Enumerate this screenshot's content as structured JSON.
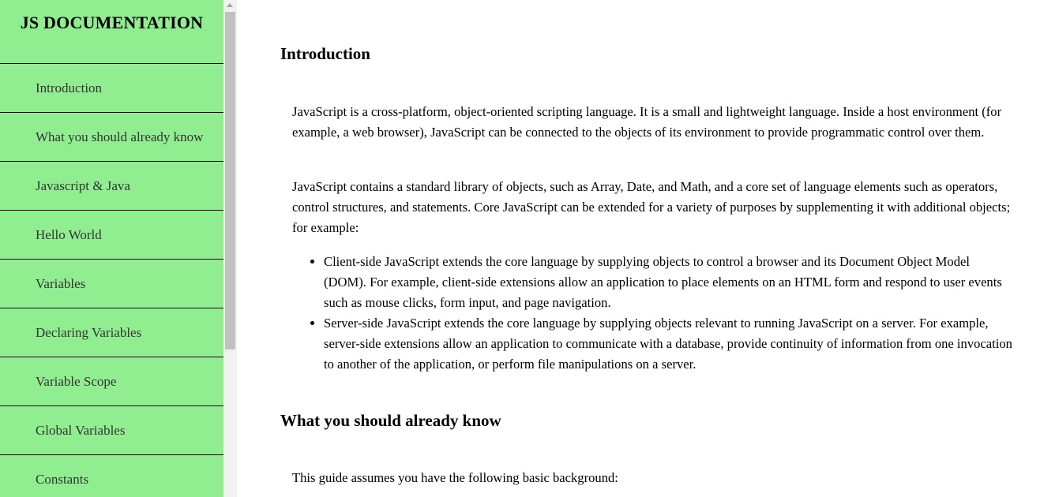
{
  "navbar": {
    "title": "JS DOCUMENTATION",
    "links": [
      "Introduction",
      "What you should already know",
      "Javascript & Java",
      "Hello World",
      "Variables",
      "Declaring Variables",
      "Variable Scope",
      "Global Variables",
      "Constants"
    ]
  },
  "sections": {
    "introduction": {
      "heading": "Introduction",
      "p1": "JavaScript is a cross-platform, object-oriented scripting language. It is a small and lightweight language. Inside a host environment (for example, a web browser), JavaScript can be connected to the objects of its environment to provide programmatic control over them.",
      "p2": "JavaScript contains a standard library of objects, such as Array, Date, and Math, and a core set of language elements such as operators, control structures, and statements. Core JavaScript can be extended for a variety of purposes by supplementing it with additional objects; for example:",
      "bullets": [
        "Client-side JavaScript extends the core language by supplying objects to control a browser and its Document Object Model (DOM). For example, client-side extensions allow an application to place elements on an HTML form and respond to user events such as mouse clicks, form input, and page navigation.",
        "Server-side JavaScript extends the core language by supplying objects relevant to running JavaScript on a server. For example, server-side extensions allow an application to communicate with a database, provide continuity of information from one invocation to another of the application, or perform file manipulations on a server."
      ]
    },
    "what_you_should_know": {
      "heading": "What you should already know",
      "p1": "This guide assumes you have the following basic background:"
    }
  },
  "colors": {
    "navbar_background": "#90ee90",
    "nav_link_text": "#333333",
    "scrollbar_thumb": "#c1c1c1"
  }
}
